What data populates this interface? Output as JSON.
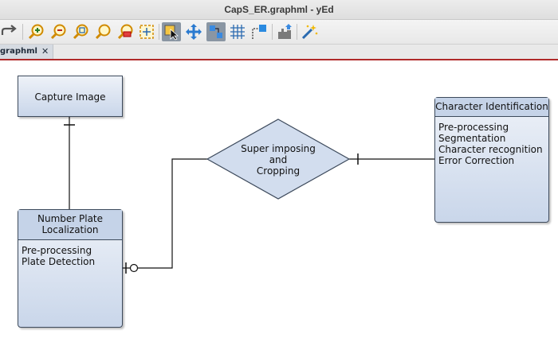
{
  "window": {
    "title": "CapS_ER.graphml - yEd"
  },
  "toolbar": {
    "icons": [
      "redo-icon",
      "zoom-in-icon",
      "zoom-out-icon",
      "zoom-fit-icon",
      "zoom-original-icon",
      "zoom-area-icon",
      "fit-content-icon",
      "edit-mode-icon",
      "move-view-icon",
      "select-mode-icon",
      "grid-icon",
      "snap-line-icon",
      "export-icon",
      "magic-wand-icon"
    ]
  },
  "tabs": [
    {
      "label": "graphml",
      "close": "✕"
    }
  ],
  "diagram": {
    "capture": {
      "label": "Capture Image"
    },
    "plate": {
      "header_line1": "Number Plate",
      "header_line2": "Localization",
      "attributes": [
        "Pre-processing",
        "Plate Detection"
      ]
    },
    "relation": {
      "line1": "Super imposing",
      "line2": "and",
      "line3": "Cropping"
    },
    "character": {
      "header": "Character Identification",
      "attributes": [
        "Pre-processing",
        "Segmentation",
        "Character recognition",
        "Error Correction"
      ]
    }
  }
}
